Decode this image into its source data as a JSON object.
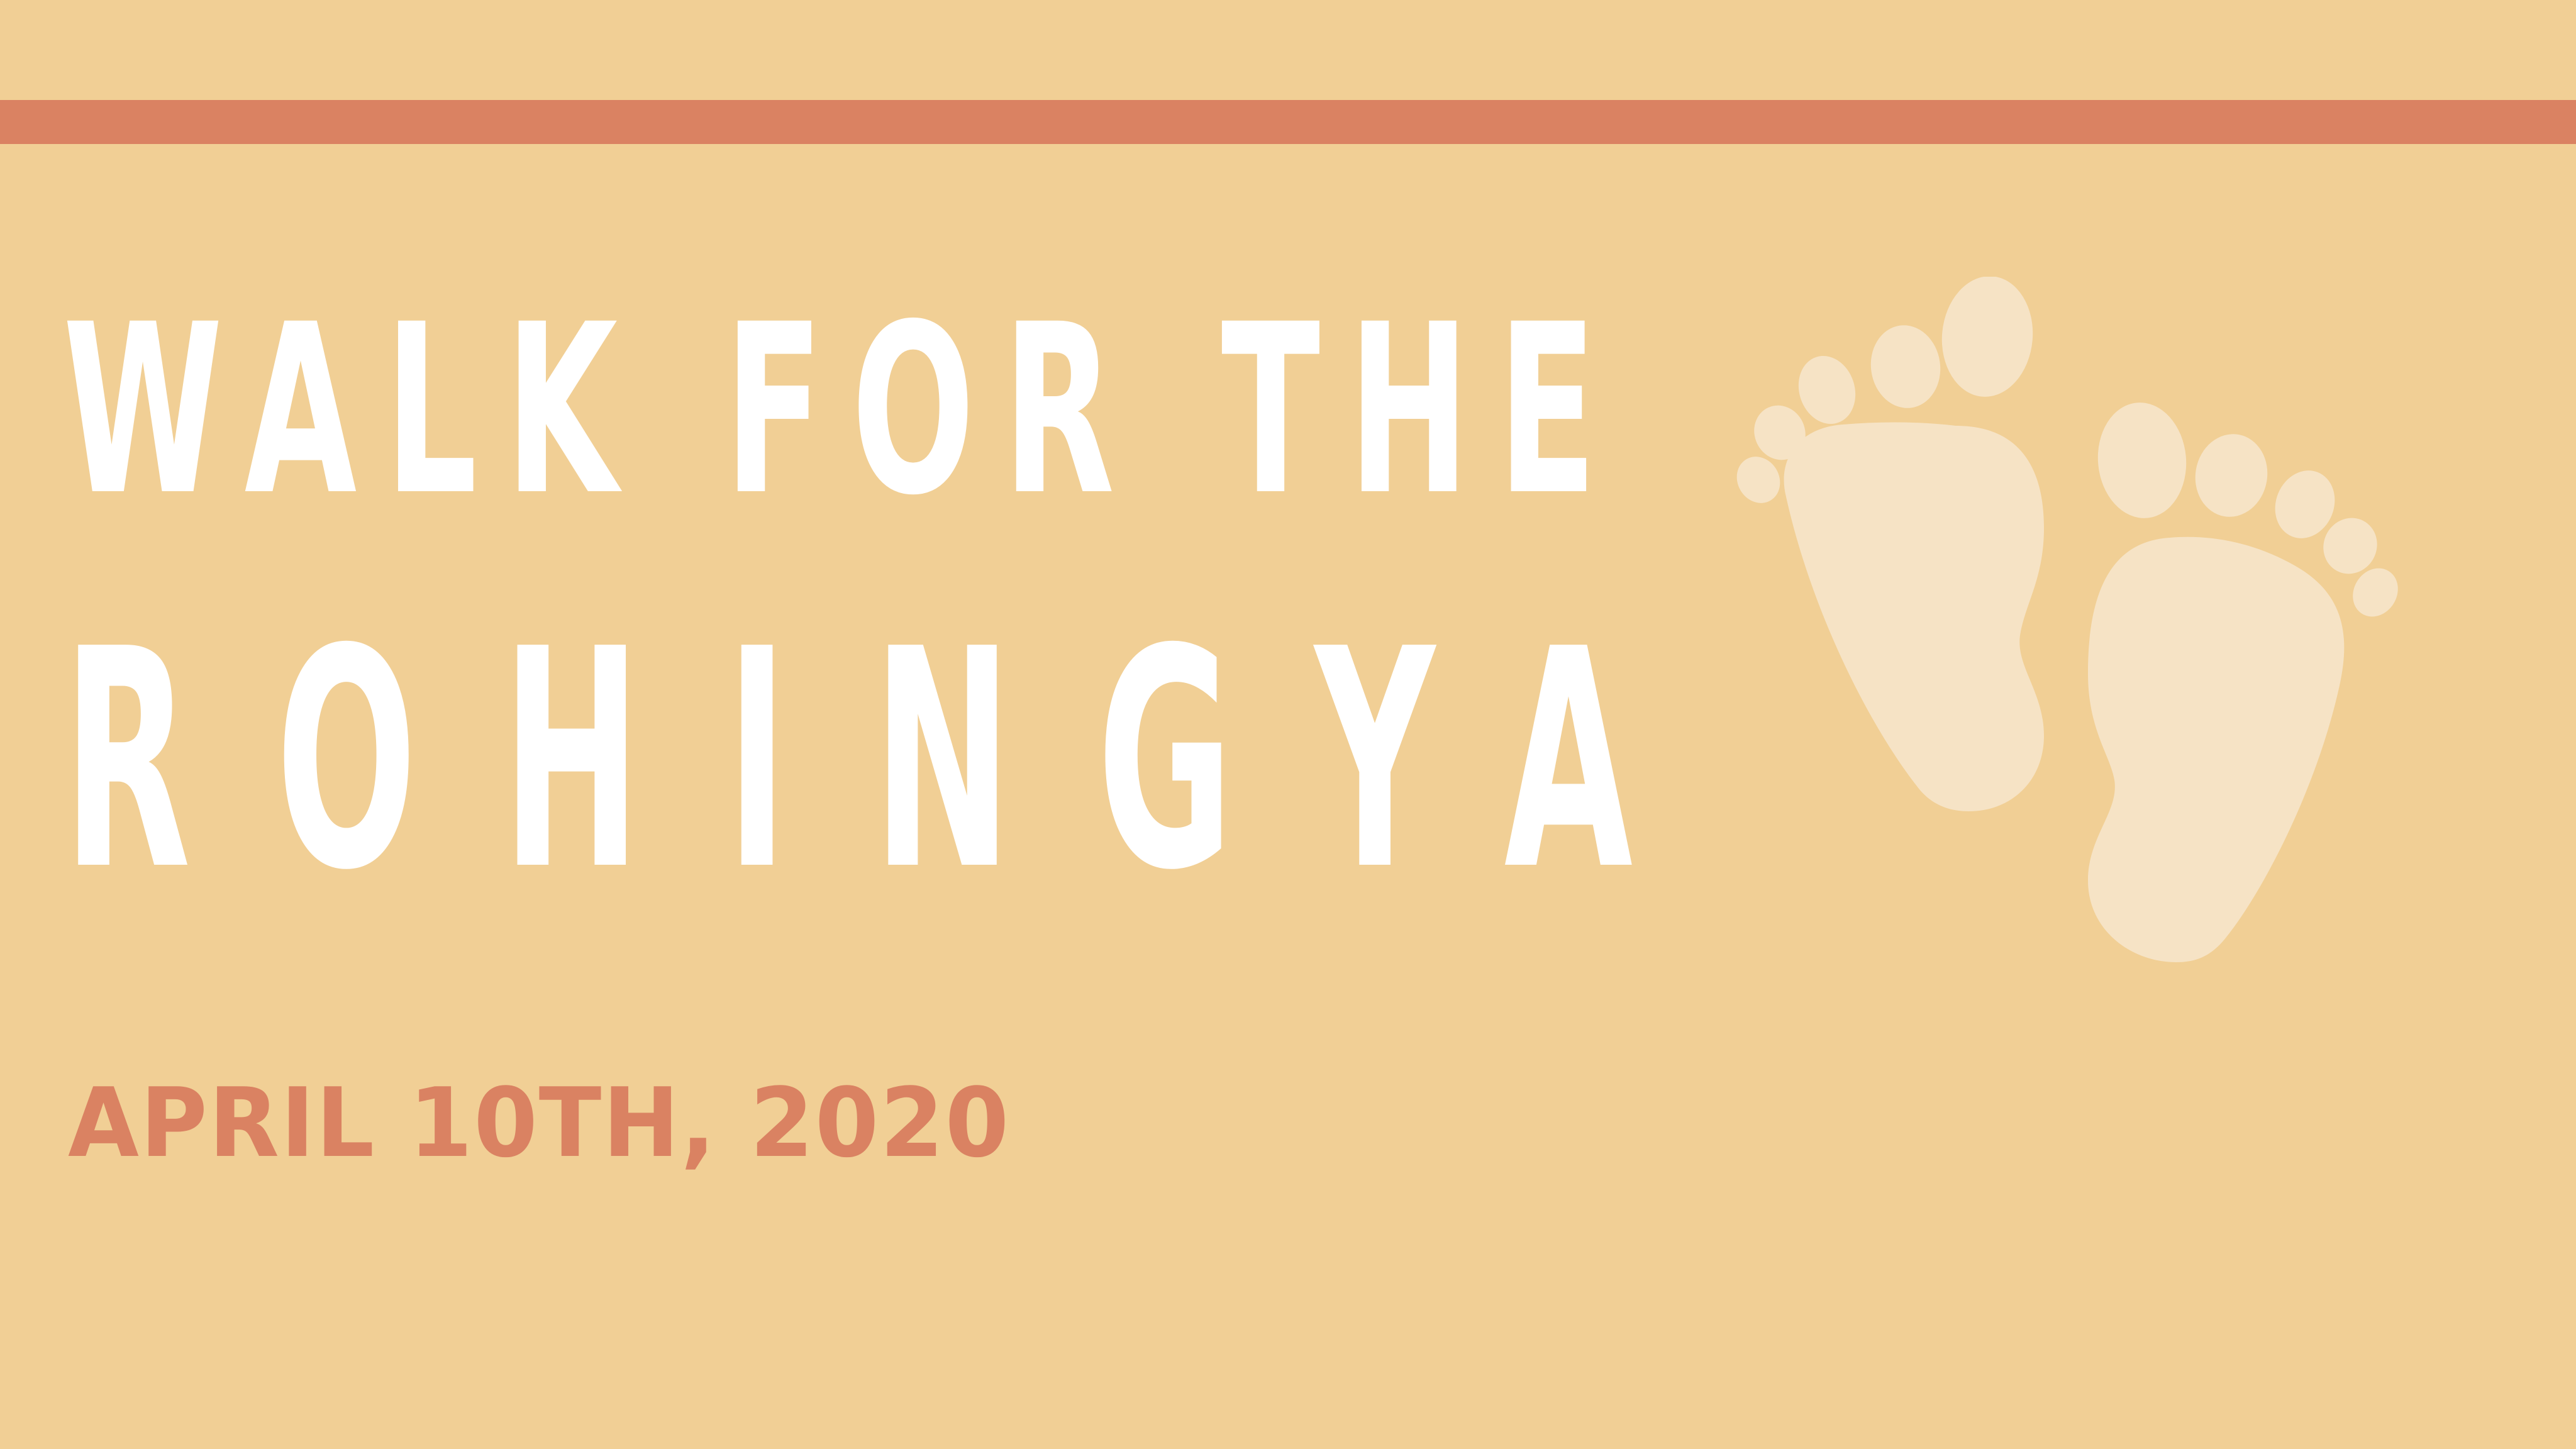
{
  "title": {
    "line1": "WALK FOR THE",
    "line2": "ROHINGYA"
  },
  "date": "APRIL 10TH, 2020",
  "icons": {
    "feet": "footprints-icon"
  },
  "colors": {
    "background": "#F1CF95",
    "accent": "#DA8262",
    "title_text": "#FFFFFF",
    "footprints": "#F6E3C5"
  }
}
